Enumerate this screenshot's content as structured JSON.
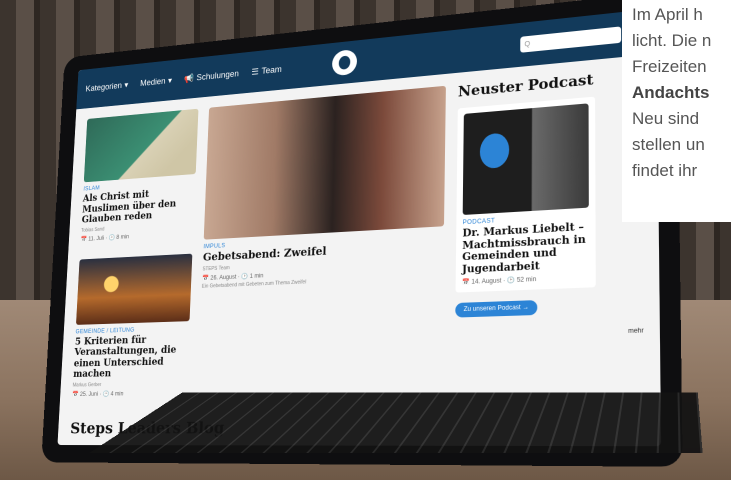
{
  "nav": {
    "items": [
      {
        "label": "Kategorien",
        "icon": "chevron-down-icon"
      },
      {
        "label": "Medien",
        "icon": "chevron-down-icon"
      },
      {
        "label": "Schulungen",
        "icon": "megaphone-icon"
      },
      {
        "label": "Team",
        "icon": "team-icon"
      }
    ],
    "search_placeholder": "Q"
  },
  "articles": [
    {
      "kicker": "Islam",
      "title": "Als Christ mit Muslimen über den Glauben reden",
      "author": "Tobias Sand",
      "meta": "📅 11. Juli · 🕑 8 min"
    },
    {
      "kicker": "Gemeinde / Leitung",
      "title": "5 Kriterien für Veranstaltungen, die einen Unterschied machen",
      "author": "Markus Gerber",
      "meta": "📅 25. Juni · 🕑 4 min"
    }
  ],
  "featured": {
    "kicker": "Impuls",
    "title": "Gebetsabend: Zweifel",
    "author": "STEPS Team",
    "meta": "📅 26. August · 🕑 1 min",
    "desc": "Ein Gebetsabend mit Gebeten zum Thema Zweifel"
  },
  "podcast": {
    "section_title": "Neuster Podcast",
    "kicker": "Podcast",
    "title": "Dr. Markus Liebelt – Machtmissbrauch in Gemeinden und Jugendarbeit",
    "meta": "📅 14. August · 🕑 52 min",
    "button": "Zu unseren Podcast  →"
  },
  "blog_title": "Steps Leaders Blog",
  "mehr_label": "mehr",
  "overlay": {
    "lines": [
      "Im April h",
      "licht. Die n",
      "Freizeiten"
    ],
    "bold_line": "Andachts",
    "lines2": [
      "Neu sind",
      "stellen un",
      "findet ihr"
    ]
  }
}
